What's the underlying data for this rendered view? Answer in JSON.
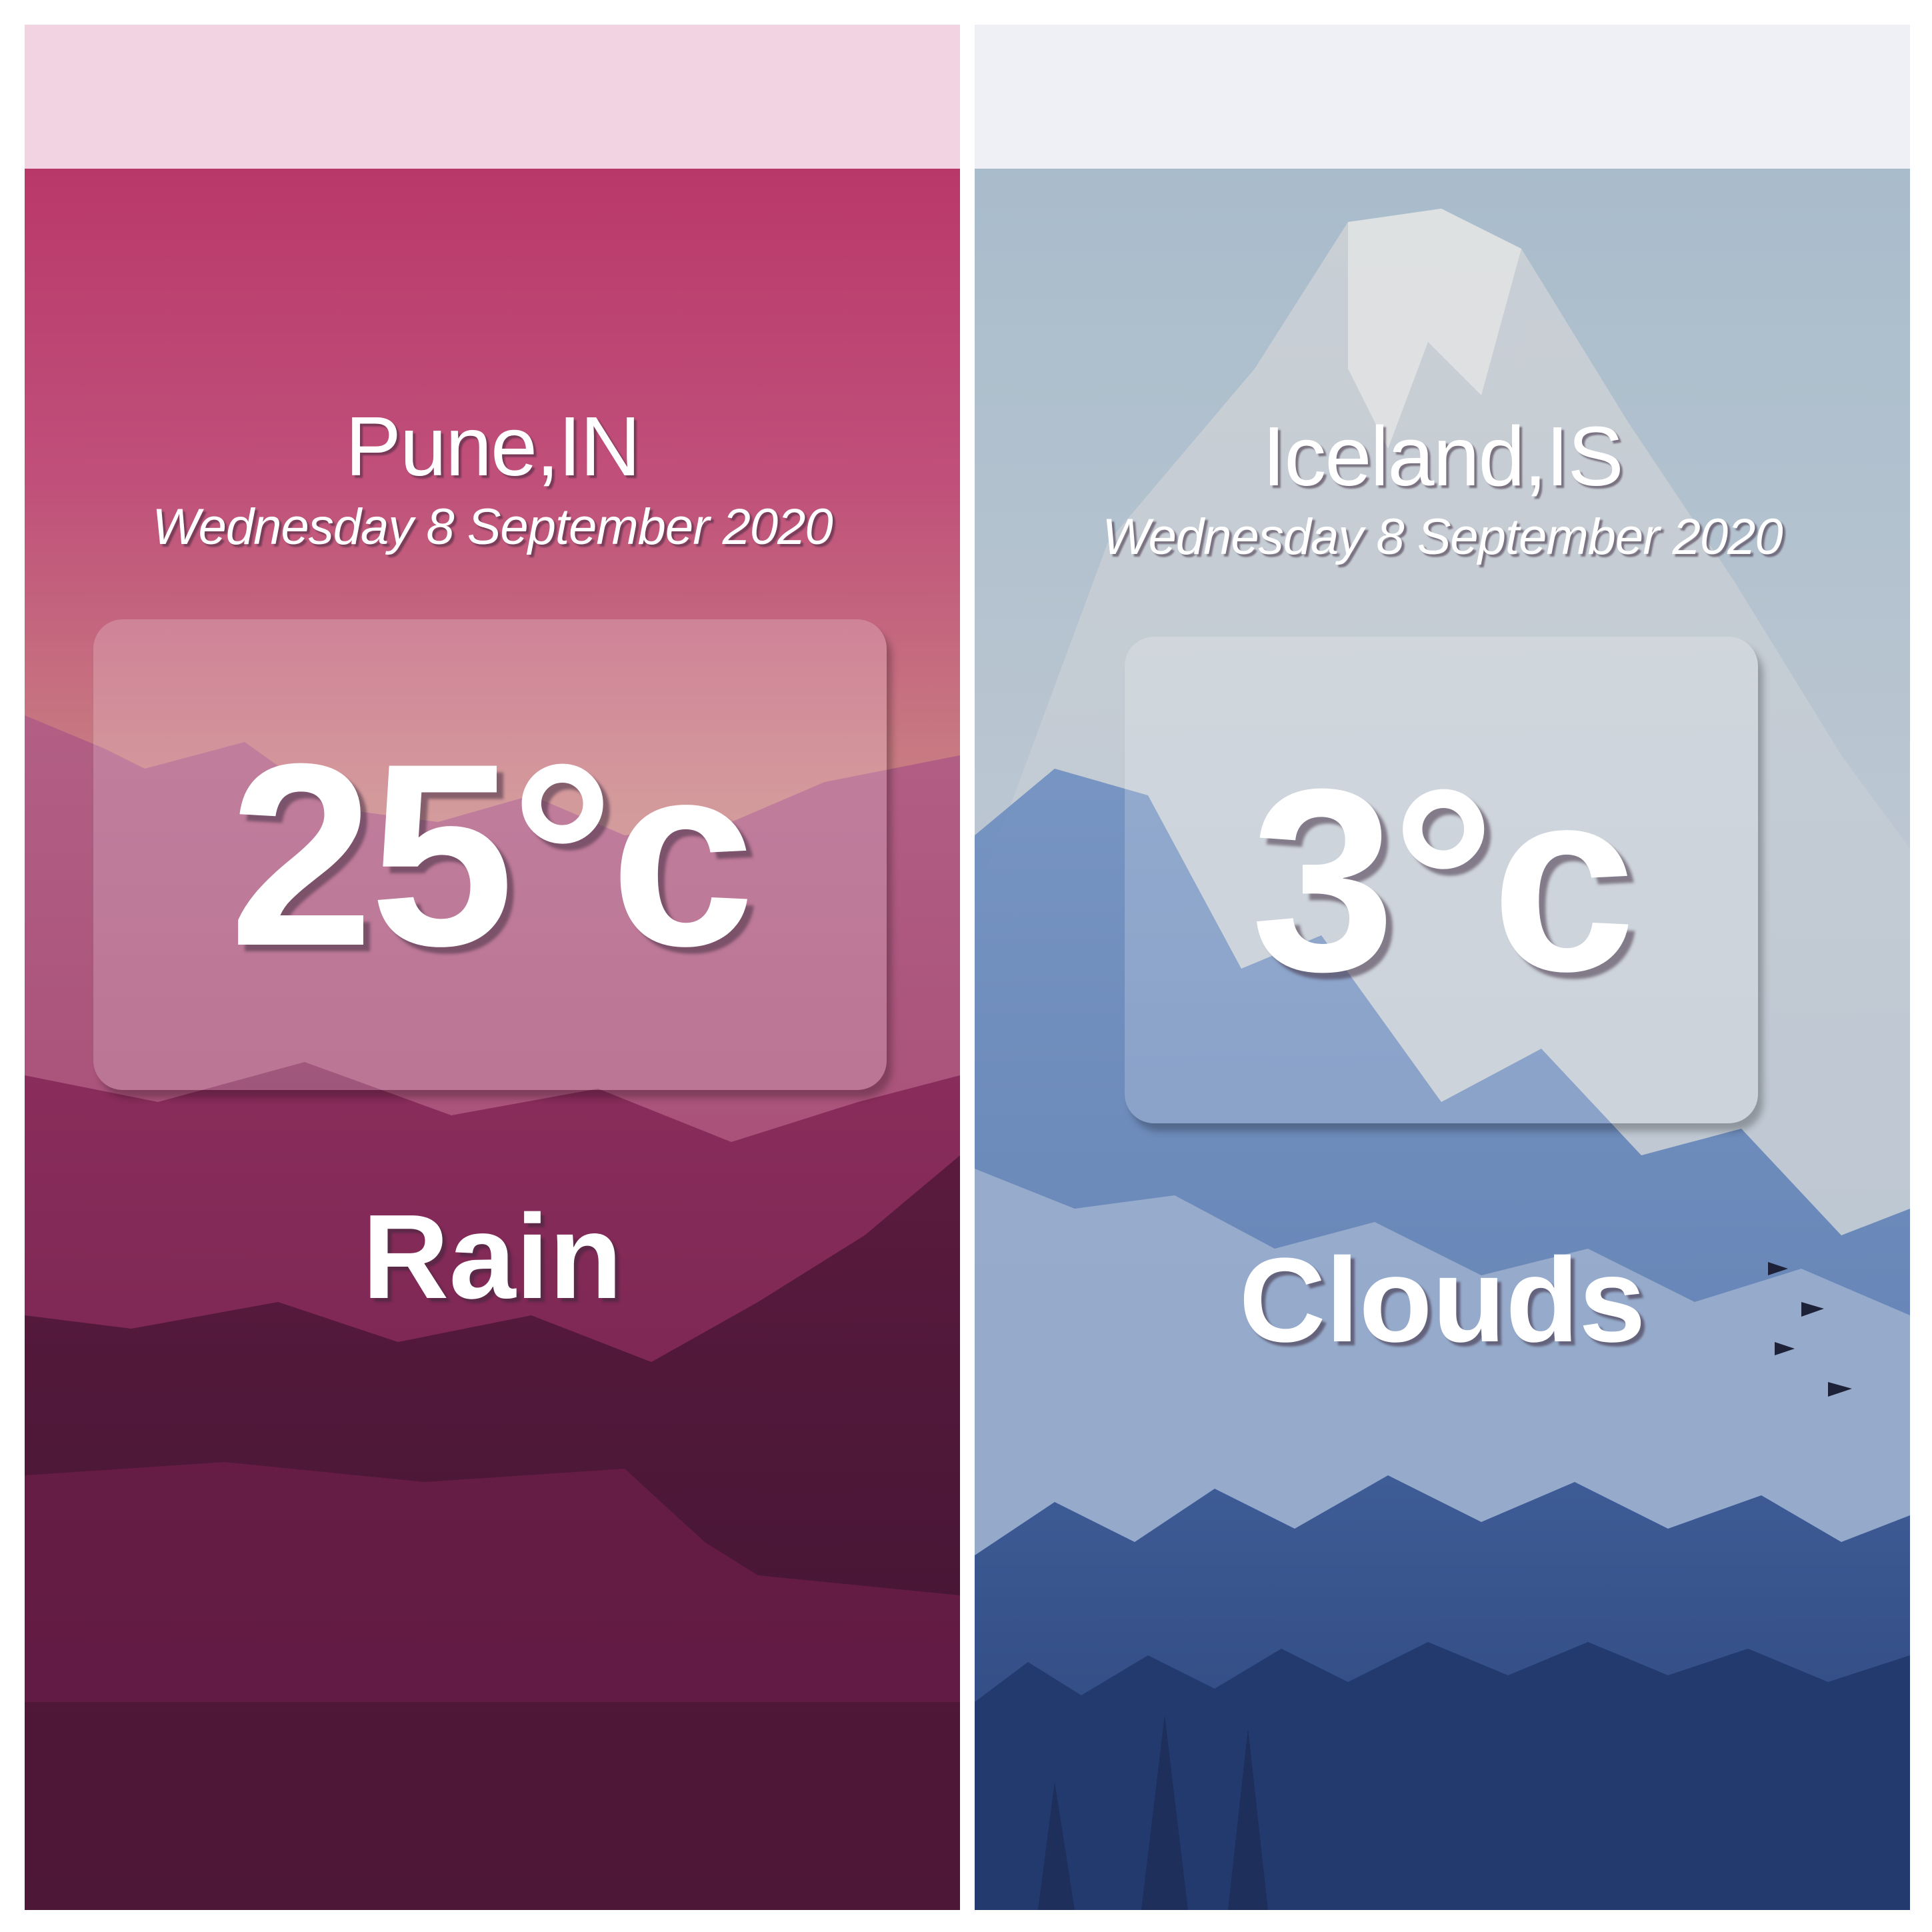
{
  "screens": [
    {
      "location": "Pune,IN",
      "date": "Wednesday 8 September 2020",
      "temperature": "25°c",
      "condition": "Rain",
      "theme_color": "#a8436e"
    },
    {
      "location": "Iceland,IS",
      "date": "Wednesday 8 September 2020",
      "temperature": "3°c",
      "condition": "Clouds",
      "theme_color": "#7d9cc4"
    }
  ]
}
